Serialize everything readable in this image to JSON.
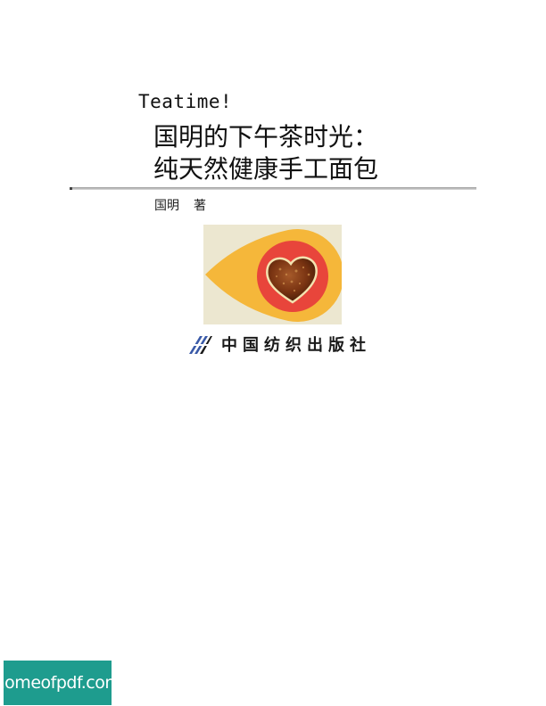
{
  "cover": {
    "series_title": "Teatime!",
    "title_line_1": "国明的下午茶时光：",
    "title_line_2": "纯天然健康手工面包",
    "author": "国明",
    "author_role": "著"
  },
  "illustration": {
    "subject": "heart-shaped bread",
    "colors": {
      "background": "#ece7d0",
      "outer_drop": "#f5b73a",
      "inner_circle": "#e8453b",
      "bread": "#7a3412"
    }
  },
  "publisher": {
    "name": "中国纺织出版社",
    "logo_color": "#3a5aa8"
  },
  "watermark": {
    "text": "homeofpdf.com",
    "color": "#1e9c8e"
  }
}
